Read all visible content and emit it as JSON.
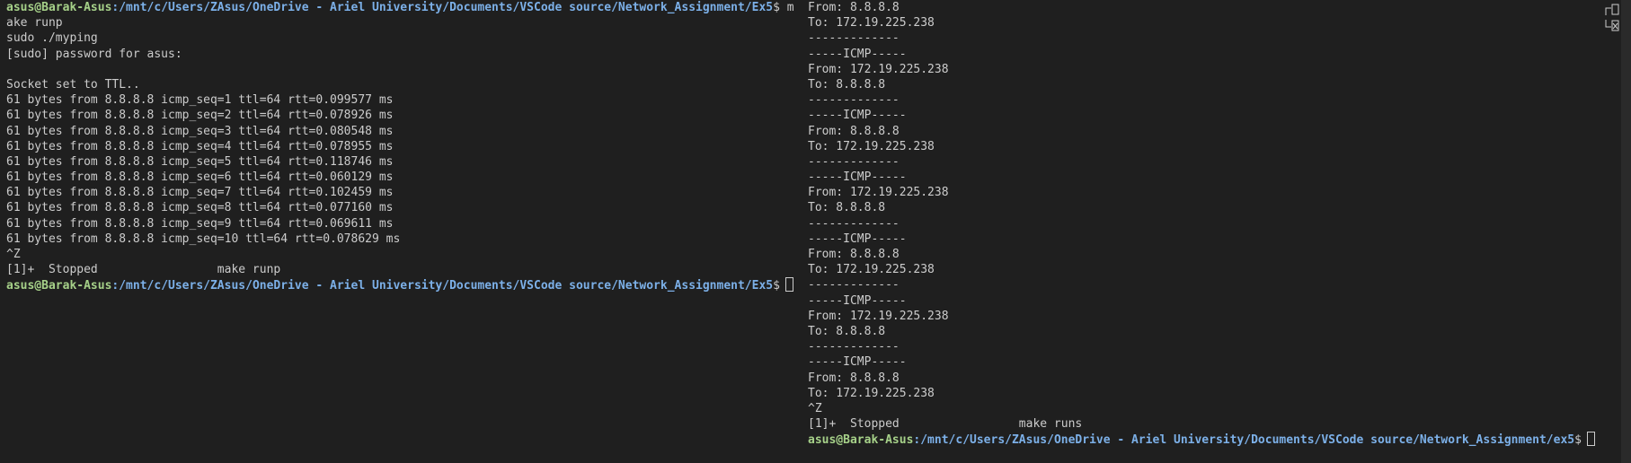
{
  "prompt": {
    "user_host": "asus@Barak-Asus",
    "left_path": ":/mnt/c/Users/ZAsus/OneDrive - Ariel University/Documents/VSCode source/Network_Assignment/Ex5",
    "right_path": ":/mnt/c/Users/ZAsus/OneDrive - Ariel University/Documents/VSCode source/Network_Assignment/ex5",
    "left_first_suffix": "$ m",
    "suffix": "$"
  },
  "left_terminal": {
    "lines": [
      "ake runp",
      "sudo ./myping",
      "[sudo] password for asus:",
      "",
      "Socket set to TTL..",
      "61 bytes from 8.8.8.8 icmp_seq=1 ttl=64 rtt=0.099577 ms",
      "61 bytes from 8.8.8.8 icmp_seq=2 ttl=64 rtt=0.078926 ms",
      "61 bytes from 8.8.8.8 icmp_seq=3 ttl=64 rtt=0.080548 ms",
      "61 bytes from 8.8.8.8 icmp_seq=4 ttl=64 rtt=0.078955 ms",
      "61 bytes from 8.8.8.8 icmp_seq=5 ttl=64 rtt=0.118746 ms",
      "61 bytes from 8.8.8.8 icmp_seq=6 ttl=64 rtt=0.060129 ms",
      "61 bytes from 8.8.8.8 icmp_seq=7 ttl=64 rtt=0.102459 ms",
      "61 bytes from 8.8.8.8 icmp_seq=8 ttl=64 rtt=0.077160 ms",
      "61 bytes from 8.8.8.8 icmp_seq=9 ttl=64 rtt=0.069611 ms",
      "61 bytes from 8.8.8.8 icmp_seq=10 ttl=64 rtt=0.078629 ms",
      "^Z",
      "[1]+  Stopped                 make runp"
    ]
  },
  "right_terminal": {
    "lines": [
      "From: 8.8.8.8",
      "To: 172.19.225.238",
      "-------------",
      "-----ICMP-----",
      "From: 172.19.225.238",
      "To: 8.8.8.8",
      "-------------",
      "-----ICMP-----",
      "From: 8.8.8.8",
      "To: 172.19.225.238",
      "-------------",
      "-----ICMP-----",
      "From: 172.19.225.238",
      "To: 8.8.8.8",
      "-------------",
      "-----ICMP-----",
      "From: 8.8.8.8",
      "To: 172.19.225.238",
      "-------------",
      "-----ICMP-----",
      "From: 172.19.225.238",
      "To: 8.8.8.8",
      "-------------",
      "-----ICMP-----",
      "From: 8.8.8.8",
      "To: 172.19.225.238",
      "^Z",
      "[1]+  Stopped                 make runs"
    ]
  },
  "colors": {
    "background": "#1f1f1f",
    "text": "#cccccc",
    "prompt_user": "#a6d189",
    "prompt_path": "#7cb0e8"
  }
}
